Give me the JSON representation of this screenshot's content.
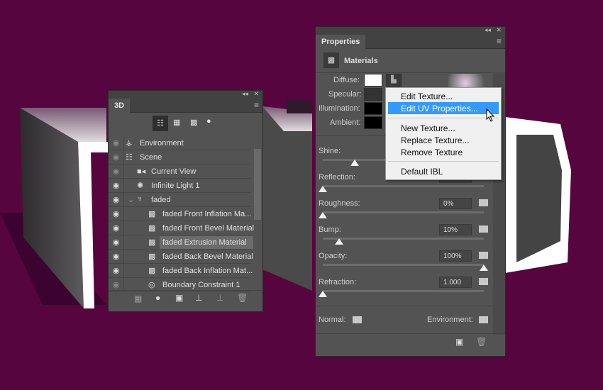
{
  "colors": {
    "background": "#56053f",
    "panel": "#535353",
    "highlight": "#3399ff"
  },
  "panel3d": {
    "tab": "3D",
    "filters": [
      {
        "icon": "scene-filter-icon",
        "active": true
      },
      {
        "icon": "mesh-filter-icon"
      },
      {
        "icon": "material-filter-icon"
      },
      {
        "icon": "light-filter-icon"
      }
    ],
    "items": [
      {
        "label": "Environment",
        "icon": "environment-icon",
        "visible": false,
        "indent": 0
      },
      {
        "label": "Scene",
        "icon": "scene-icon",
        "visible": false,
        "indent": 0
      },
      {
        "label": "Current View",
        "icon": "camera-icon",
        "visible": false,
        "indent": 1
      },
      {
        "label": "Infinite Light 1",
        "icon": "light-icon",
        "visible": true,
        "indent": 1
      },
      {
        "label": "faded",
        "icon": "mesh-icon",
        "visible": true,
        "indent": 1,
        "expanded": true
      },
      {
        "label": "faded Front Inflation Ma...",
        "icon": "material-icon",
        "visible": true,
        "indent": 2
      },
      {
        "label": "faded Front Bevel Material",
        "icon": "material-icon",
        "visible": true,
        "indent": 2
      },
      {
        "label": "faded Extrusion Material",
        "icon": "material-icon",
        "visible": true,
        "indent": 2,
        "selected": true
      },
      {
        "label": "faded Back Bevel Material",
        "icon": "material-icon",
        "visible": true,
        "indent": 2
      },
      {
        "label": "faded Back Inflation Mat...",
        "icon": "material-icon",
        "visible": true,
        "indent": 2
      },
      {
        "label": "Boundary Constraint 1",
        "icon": "constraint-icon",
        "visible": false,
        "indent": 2
      }
    ]
  },
  "properties": {
    "tab": "Properties",
    "section": "Materials",
    "diffuse": "Diffuse:",
    "specular": "Specular:",
    "illumination": "Illumination:",
    "ambient": "Ambient:",
    "sliders": [
      {
        "label": "Shine:",
        "value": "",
        "fraction": 0.2
      },
      {
        "label": "Reflection:",
        "value": "",
        "fraction": 0
      },
      {
        "label": "Roughness:",
        "value": "0%",
        "fraction": 0
      },
      {
        "label": "Bump:",
        "value": "10%",
        "fraction": 0.1
      },
      {
        "label": "Opacity:",
        "value": "100%",
        "fraction": 1
      },
      {
        "label": "Refraction:",
        "value": "1.000",
        "fraction": 0
      }
    ],
    "normal": "Normal:",
    "environment": "Environment:"
  },
  "context_menu": {
    "items": [
      "Edit Texture...",
      "Edit UV Properties...",
      "New Texture...",
      "Replace Texture...",
      "Remove Texture",
      "Default IBL"
    ],
    "highlighted": "Edit UV Properties..."
  }
}
